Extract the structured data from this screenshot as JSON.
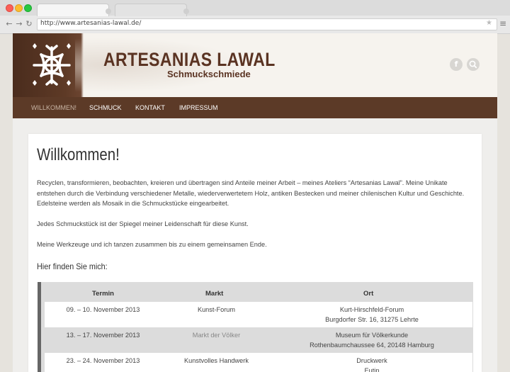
{
  "browser": {
    "url": "http://www.artesanias-lawal.de/",
    "back_icon": "back-arrow-icon",
    "forward_icon": "forward-arrow-icon",
    "reload_icon": "reload-icon"
  },
  "header": {
    "title": "ARTESANIAS LAWAL",
    "subtitle": "Schmuckschmiede",
    "social": [
      "facebook-icon",
      "search-icon"
    ]
  },
  "nav": {
    "items": [
      "WILLKOMMEN!",
      "SCHMUCK",
      "KONTAKT",
      "IMPRESSUM"
    ],
    "active": "WILLKOMMEN!"
  },
  "main": {
    "heading": "Willkommen!",
    "paragraphs": [
      "Recyclen, transformieren, beobachten, kreieren und übertragen sind Anteile meiner Arbeit – meines Ateliers “Artesanias Lawal”. Meine Unikate entstehen durch die Verbindung verschiedener Metalle, wiederverwertetem Holz, antiken Bestecken und meiner chilenischen Kultur und Geschichte. Edelsteine werden als Mosaik in die Schmuckstücke eingearbeitet.",
      "Jedes Schmuckstück ist der Spiegel meiner Leidenschaft für diese Kunst.",
      "Meine Werkzeuge und ich tanzen zusammen bis zu einem gemeinsamen Ende."
    ],
    "subheading": "Hier finden Sie mich:"
  },
  "table": {
    "headers": [
      "Termin",
      "Markt",
      "Ort"
    ],
    "rows": [
      {
        "termin": "09. – 10. November 2013",
        "markt": "Kunst-Forum",
        "ort1": "Kurt-Hirschfeld-Forum",
        "ort2": "Burgdorfer Str. 16, 31275 Lehrte"
      },
      {
        "termin": "13. – 17. November 2013",
        "markt": "Markt der Völker",
        "ort1": "Museum für Völkerkunde",
        "ort2": "Rothenbaumchaussee 64, 20148 Hamburg"
      },
      {
        "termin": "23. – 24. November 2013",
        "markt": "Kunstvolles Handwerk",
        "ort1": "Druckwerk",
        "ort2": "Eutin"
      }
    ]
  },
  "colors": {
    "brand_brown": "#5c3a27",
    "title_brown": "#5a3322"
  }
}
